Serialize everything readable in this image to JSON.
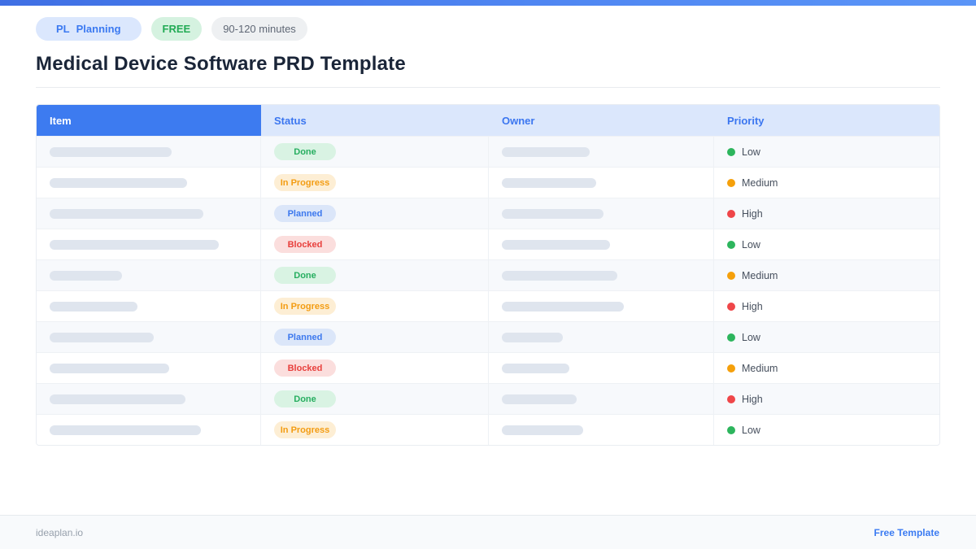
{
  "theme": {
    "accent": "#3b76f0",
    "top_strip_gradient": [
      "#3f6fe4",
      "#5b95f7"
    ],
    "header_item_bg": "#3d7bf0",
    "header_other_bg": "#dbe7fc",
    "row_alt_bg": "#f7f9fc",
    "placeholder_bar_color": "#dfe5ee"
  },
  "header": {
    "pills": [
      {
        "id": "category",
        "prefix": "PL",
        "label": "Planning",
        "bg": "#dbe7fd",
        "color": "#3b79f1"
      },
      {
        "id": "free",
        "label": "FREE",
        "bg": "#d5f2e0",
        "color": "#22ab55"
      },
      {
        "id": "duration",
        "label": "90-120 minutes",
        "bg": "#eef0f2",
        "color": "#5f6775"
      }
    ],
    "title": "Medical Device Software PRD Template"
  },
  "table": {
    "columns": [
      "Item",
      "Status",
      "Owner",
      "Priority"
    ],
    "rows": [
      {
        "item_bar_width": 150,
        "status": "Done",
        "owner_bar_width": 108,
        "priority": "Low"
      },
      {
        "item_bar_width": 169,
        "status": "In Progress",
        "owner_bar_width": 116,
        "priority": "Medium"
      },
      {
        "item_bar_width": 189,
        "status": "Planned",
        "owner_bar_width": 125,
        "priority": "High"
      },
      {
        "item_bar_width": 208,
        "status": "Blocked",
        "owner_bar_width": 133,
        "priority": "Low"
      },
      {
        "item_bar_width": 89,
        "status": "Done",
        "owner_bar_width": 142,
        "priority": "Medium"
      },
      {
        "item_bar_width": 108,
        "status": "In Progress",
        "owner_bar_width": 150,
        "priority": "High"
      },
      {
        "item_bar_width": 128,
        "status": "Planned",
        "owner_bar_width": 75,
        "priority": "Low"
      },
      {
        "item_bar_width": 147,
        "status": "Blocked",
        "owner_bar_width": 83,
        "priority": "Medium"
      },
      {
        "item_bar_width": 167,
        "status": "Done",
        "owner_bar_width": 92,
        "priority": "High"
      },
      {
        "item_bar_width": 186,
        "status": "In Progress",
        "owner_bar_width": 100,
        "priority": "Low"
      }
    ]
  },
  "status_styles": {
    "Done": {
      "bg": "#d9f3e3",
      "color": "#27ae60"
    },
    "In Progress": {
      "bg": "#fdeed4",
      "color": "#f39c12"
    },
    "Planned": {
      "bg": "#dbe6f9",
      "color": "#3c78ee"
    },
    "Blocked": {
      "bg": "#fbdedd",
      "color": "#e8403d"
    }
  },
  "priority_styles": {
    "Low": "#2db55d",
    "Medium": "#f5a00b",
    "High": "#ef4649"
  },
  "footer": {
    "left": "ideaplan.io",
    "right": "Free Template"
  }
}
